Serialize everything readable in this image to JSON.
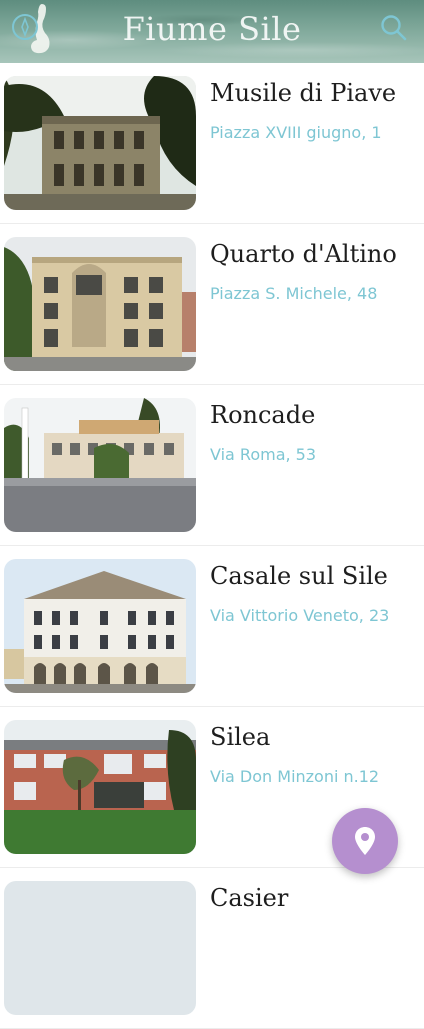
{
  "header": {
    "title": "Fiume Sile"
  },
  "icons": {
    "left": "compass-icon",
    "right": "search-icon",
    "fab": "map-pin-icon"
  },
  "colors": {
    "accent": "#7ec6d3",
    "fab": "#b58fcf",
    "title": "#1e1e1e"
  },
  "items": [
    {
      "title": "Musile di Piave",
      "address": "Piazza XVIII giugno, 1"
    },
    {
      "title": "Quarto d'Altino",
      "address": "Piazza S. Michele, 48"
    },
    {
      "title": "Roncade",
      "address": "Via Roma, 53"
    },
    {
      "title": "Casale sul Sile",
      "address": "Via Vittorio Veneto, 23"
    },
    {
      "title": "Silea",
      "address": "Via Don Minzoni n.12"
    },
    {
      "title": "Casier",
      "address": ""
    }
  ]
}
